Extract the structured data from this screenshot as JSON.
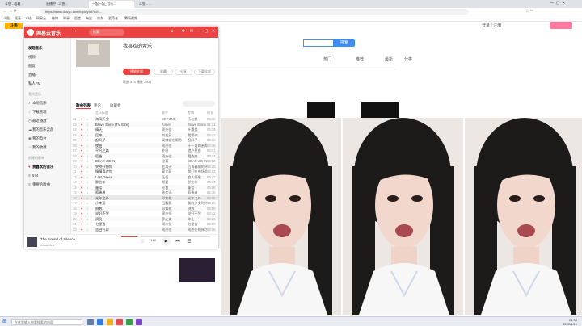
{
  "browser": {
    "tabs": [
      "斗鱼 - 陪着...",
      "直播中 - 斗鱼...",
      "一起一起_音乐...",
      "斗鱼 - ..."
    ],
    "url": "https://www.douyu.com/topic/yiqi?rid=...",
    "bookmarks": [
      "斗鱼",
      "虎牙",
      "B站",
      "网易云",
      "微博",
      "知乎",
      "百度",
      "淘宝",
      "京东",
      "爱奇艺",
      "腾讯视频"
    ]
  },
  "site": {
    "search_button": "搜索",
    "nav_right": [
      "登录",
      "注册"
    ],
    "section_tabs": [
      "热门",
      "推荐",
      "最新",
      "分类"
    ]
  },
  "player": {
    "app_name": "网易云音乐",
    "search_placeholder": "搜索",
    "sidebar": {
      "items": [
        "发现音乐",
        "视频",
        "朋友",
        "直播",
        "私人FM"
      ],
      "section_my": "我的音乐",
      "my_items": [
        "本地音乐",
        "下载管理",
        "最近播放",
        "我的音乐云盘",
        "我的电台",
        "我的收藏"
      ],
      "section_created": "创建的歌单",
      "created_items": [
        "我喜欢的音乐",
        "574",
        "重要的歌曲"
      ]
    },
    "playlist": {
      "title": "我喜欢的音乐",
      "play_all": "播放全部",
      "collect": "收藏",
      "share": "分享",
      "download": "下载全部",
      "meta": "歌曲 574  播放 1904",
      "tabs": [
        "歌曲列表",
        "评论",
        "收藏者"
      ],
      "columns": [
        "音乐标题",
        "歌手",
        "专辑",
        "时长"
      ],
      "songs": [
        {
          "title": "海阔天空",
          "artist": "BEYOND",
          "album": "乐与怒",
          "time": "05:26"
        },
        {
          "title": "Brave Shine (TV Size)",
          "artist": "Aimer",
          "album": "Brave Shine",
          "time": "01:31"
        },
        {
          "title": "晴天",
          "artist": "周杰伦",
          "album": "叶惠美",
          "time": "04:29"
        },
        {
          "title": "后来",
          "artist": "刘若英",
          "album": "我等你",
          "time": "05:41"
        },
        {
          "title": "起风了",
          "artist": "买辣椒也用券",
          "album": "起风了",
          "time": "05:25"
        },
        {
          "title": "夜曲",
          "artist": "周杰伦",
          "album": "十一月的萧邦",
          "time": "03:46"
        },
        {
          "title": "平凡之路",
          "artist": "朴树",
          "album": "猎户星座",
          "time": "05:01"
        },
        {
          "title": "稻香",
          "artist": "周杰伦",
          "album": "魔杰座",
          "time": "03:43"
        },
        {
          "title": "DEAR JOHN",
          "artist": "比莉",
          "album": "DEAR JOHN",
          "time": "03:52"
        },
        {
          "title": "突然好想你",
          "artist": "五月天",
          "album": "后青春期的诗",
          "time": "04:25"
        },
        {
          "title": "慢慢喜欢你",
          "artist": "莫文蔚",
          "album": "我们在中场相遇",
          "time": "04:02"
        },
        {
          "title": "Last Dance",
          "artist": "伍佰",
          "album": "浪人情歌",
          "time": "04:42"
        },
        {
          "title": "那些年",
          "artist": "胡夏",
          "album": "那些年",
          "time": "06:17"
        },
        {
          "title": "童话",
          "artist": "光良",
          "album": "童话",
          "time": "04:06"
        },
        {
          "title": "孤勇者",
          "artist": "陈奕迅",
          "album": "孤勇者",
          "time": "04:16"
        },
        {
          "title": "光年之外",
          "artist": "邓紫棋",
          "album": "光年之外",
          "time": "03:55"
        },
        {
          "title": "小幸运",
          "artist": "田馥甄",
          "album": "我的少女时代",
          "time": "04:25"
        },
        {
          "title": "倒数",
          "artist": "邓紫棋",
          "album": "倒数",
          "time": "03:50"
        },
        {
          "title": "说好不哭",
          "artist": "周杰伦",
          "album": "说好不哭",
          "time": "03:42"
        },
        {
          "title": "演员",
          "artist": "薛之谦",
          "album": "绅士",
          "time": "04:21"
        },
        {
          "title": "七里香",
          "artist": "周杰伦",
          "album": "七里香",
          "time": "04:59"
        },
        {
          "title": "告白气球",
          "artist": "周杰伦",
          "album": "周杰伦的床边故事",
          "time": "03:35"
        }
      ]
    },
    "now_playing": {
      "title": "The Sound of Silence",
      "artist": "Disturbed",
      "progress": 0.18
    }
  },
  "taskbar": {
    "search_placeholder": "在这里输入你要搜索的内容",
    "time": "21:34",
    "date": "2022/4/16"
  },
  "colors": {
    "player_red": "#ec4141",
    "taskbar_bg": "#e8ecf2"
  }
}
